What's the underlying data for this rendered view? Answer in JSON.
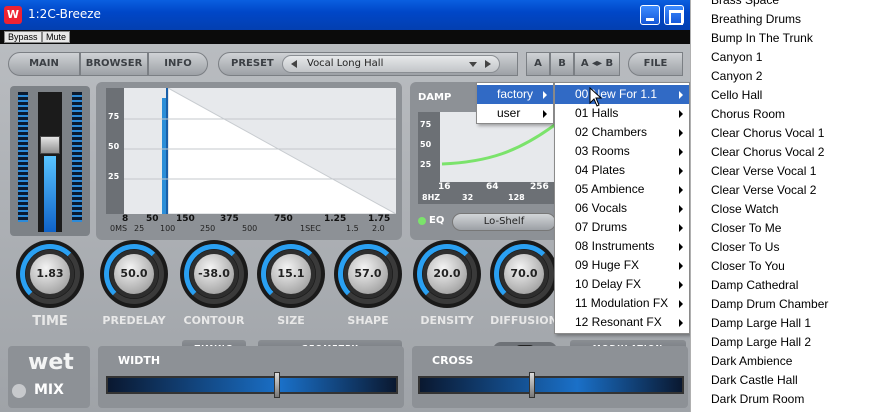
{
  "window": {
    "title": "1:2C-Breeze",
    "app_icon_letter": "W",
    "bypass_label": "Bypass",
    "mute_label": "Mute"
  },
  "nav": {
    "main": "MAIN",
    "browser": "BROWSER",
    "info": "INFO",
    "preset_label": "PRESET",
    "preset_value": "Vocal Long Hall",
    "a": "A",
    "b": "B",
    "ab": "A ◂▸ B",
    "file": "FILE"
  },
  "graph": {
    "y_labels": [
      "75",
      "50",
      "25"
    ],
    "x_top": [
      "8",
      "50",
      "150",
      "375",
      "750",
      "1.25",
      "1.75"
    ],
    "x_bottom": [
      "0MS",
      "25",
      "100",
      "250",
      "500",
      "1SEC",
      "1.5",
      "2.0"
    ]
  },
  "damp": {
    "label": "DAMP",
    "y_labels": [
      "75",
      "50",
      "25"
    ],
    "x_top": [
      "16",
      "64",
      "256"
    ],
    "x_bottom": [
      "8HZ",
      "32",
      "128"
    ],
    "eq_label": "EQ",
    "eq_mode": "Lo-Shelf"
  },
  "knobs": [
    {
      "label": "TIME",
      "value": "1.83"
    },
    {
      "label": "PREDELAY",
      "value": "50.0"
    },
    {
      "label": "CONTOUR",
      "value": "-38.0"
    },
    {
      "label": "SIZE",
      "value": "15.1"
    },
    {
      "label": "SHAPE",
      "value": "57.0"
    },
    {
      "label": "DENSITY",
      "value": "20.0"
    },
    {
      "label": "DIFFUSION",
      "value": "70.0"
    }
  ],
  "sections": {
    "timing": "TIMING",
    "geometry": "GEOMETRY",
    "modulation": "MODULATION",
    "lo": "LO",
    "hi": "HI"
  },
  "mix": {
    "wet": "wet",
    "mix": "MIX",
    "width": "WIDTH",
    "cross": "CROSS",
    "width_value": 0.58,
    "cross_value": 0.42
  },
  "menu1": {
    "items": [
      "factory",
      "user"
    ]
  },
  "menu2": {
    "items": [
      "00 New For 1.1",
      "01 Halls",
      "02 Chambers",
      "03 Rooms",
      "04 Plates",
      "05 Ambience",
      "06 Vocals",
      "07 Drums",
      "08 Instruments",
      "09 Huge FX",
      "10 Delay FX",
      "11 Modulation FX",
      "12 Resonant FX"
    ]
  },
  "preset_list": {
    "items": [
      "Brass Space",
      "Breathing Drums",
      "Bump In The Trunk",
      "Canyon 1",
      "Canyon 2",
      "Cello Hall",
      "Chorus Room",
      "Clear Chorus Vocal 1",
      "Clear Chorus Vocal 2",
      "Clear Verse Vocal 1",
      "Clear Verse Vocal 2",
      "Close Watch",
      "Closer To Me",
      "Closer To Us",
      "Closer To You",
      "Damp Cathedral",
      "Damp Drum Chamber",
      "Damp Large Hall 1",
      "Damp Large Hall 2",
      "Dark Ambience",
      "Dark Castle Hall",
      "Dark Drum Room"
    ]
  }
}
